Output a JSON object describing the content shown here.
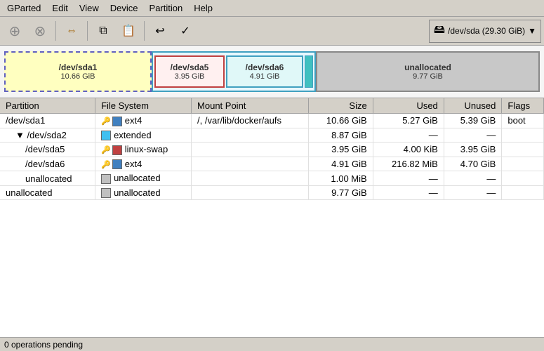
{
  "app": {
    "title": "GParted"
  },
  "menubar": {
    "items": [
      {
        "label": "GParted"
      },
      {
        "label": "Edit"
      },
      {
        "label": "View"
      },
      {
        "label": "Device"
      },
      {
        "label": "Partition"
      },
      {
        "label": "Help"
      }
    ]
  },
  "toolbar": {
    "buttons": [
      {
        "name": "new-button",
        "icon": "⊕",
        "tooltip": "New"
      },
      {
        "name": "delete-button",
        "icon": "⊘",
        "tooltip": "Delete"
      },
      {
        "name": "resize-button",
        "icon": "→",
        "tooltip": "Resize"
      },
      {
        "name": "copy-button",
        "icon": "⧉",
        "tooltip": "Copy"
      },
      {
        "name": "paste-button",
        "icon": "📋",
        "tooltip": "Paste"
      },
      {
        "name": "undo-button",
        "icon": "↩",
        "tooltip": "Undo"
      },
      {
        "name": "apply-button",
        "icon": "✓",
        "tooltip": "Apply"
      }
    ],
    "device": {
      "icon": "💾",
      "label": "/dev/sda  (29.30 GiB)",
      "dropdown": "▼"
    }
  },
  "disk_visual": {
    "partitions": [
      {
        "id": "sda1",
        "label": "/dev/sda1",
        "size": "10.66 GiB"
      },
      {
        "id": "sda5",
        "label": "/dev/sda5",
        "size": "3.95 GiB"
      },
      {
        "id": "sda6",
        "label": "/dev/sda6",
        "size": "4.91 GiB"
      },
      {
        "id": "unallocated",
        "label": "unallocated",
        "size": "9.77 GiB"
      }
    ]
  },
  "table": {
    "headers": [
      {
        "label": "Partition"
      },
      {
        "label": "File System"
      },
      {
        "label": "Mount Point"
      },
      {
        "label": "Size"
      },
      {
        "label": "Used"
      },
      {
        "label": "Unused"
      },
      {
        "label": "Flags"
      }
    ],
    "rows": [
      {
        "partition": "/dev/sda1",
        "indent": 0,
        "fs_color": "#4080c0",
        "fs_label": "ext4",
        "mount": "/, /var/lib/docker/aufs",
        "size": "10.66 GiB",
        "used": "5.27 GiB",
        "unused": "5.39 GiB",
        "flags": "boot"
      },
      {
        "partition": "/dev/sda2",
        "indent": 1,
        "fs_color": "#40c0f0",
        "fs_label": "extended",
        "mount": "",
        "size": "8.87 GiB",
        "used": "—",
        "unused": "—",
        "flags": ""
      },
      {
        "partition": "/dev/sda5",
        "indent": 2,
        "fs_color": "#c04040",
        "fs_label": "linux-swap",
        "mount": "",
        "size": "3.95 GiB",
        "used": "4.00 KiB",
        "unused": "3.95 GiB",
        "flags": ""
      },
      {
        "partition": "/dev/sda6",
        "indent": 2,
        "fs_color": "#4080c0",
        "fs_label": "ext4",
        "mount": "",
        "size": "4.91 GiB",
        "used": "216.82 MiB",
        "unused": "4.70 GiB",
        "flags": ""
      },
      {
        "partition": "unallocated",
        "indent": 2,
        "fs_color": "#c0c0c0",
        "fs_label": "unallocated",
        "mount": "",
        "size": "1.00 MiB",
        "used": "—",
        "unused": "—",
        "flags": ""
      },
      {
        "partition": "unallocated",
        "indent": 0,
        "fs_color": "#c0c0c0",
        "fs_label": "unallocated",
        "mount": "",
        "size": "9.77 GiB",
        "used": "—",
        "unused": "—",
        "flags": ""
      }
    ]
  },
  "statusbar": {
    "text": "0 operations pending"
  }
}
